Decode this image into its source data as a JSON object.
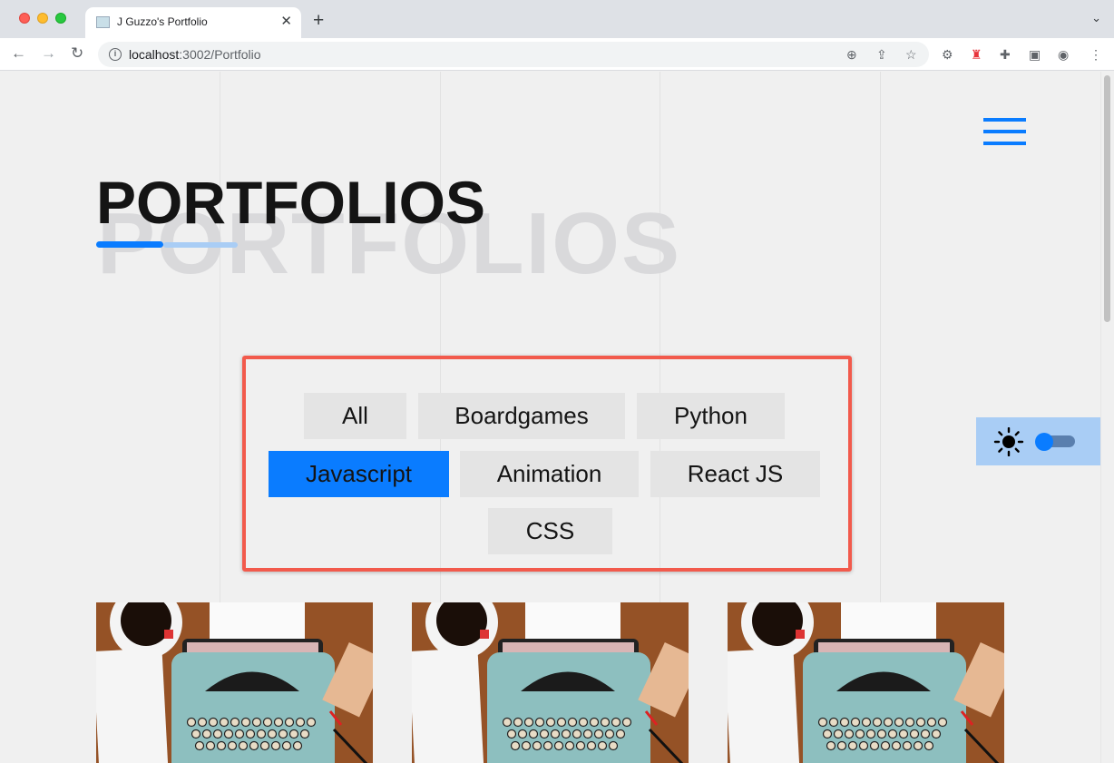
{
  "browser": {
    "tab_title": "J Guzzo's Portfolio",
    "tab_close": "✕",
    "new_tab": "+",
    "tab_menu": "⌄",
    "url_host": "localhost",
    "url_path": ":3002/Portfolio",
    "nav": {
      "back": "←",
      "forward": "→",
      "reload": "↻"
    },
    "omnibox_icons": {
      "zoom": "⊕",
      "share": "⇪",
      "bookmark": "☆"
    },
    "toolbar_icons": {
      "extension_1": "⚙",
      "extension_2": "♜",
      "extensions": "✚",
      "sidepanel": "▣",
      "profile": "◉",
      "menu": "⋮"
    }
  },
  "page": {
    "title": "PORTFOLIOS",
    "background_title": "PORTFOLIOS",
    "accent_color": "#0a7cff",
    "filters": [
      {
        "label": "All",
        "active": false
      },
      {
        "label": "Boardgames",
        "active": false
      },
      {
        "label": "Python",
        "active": false
      },
      {
        "label": "Javascript",
        "active": true
      },
      {
        "label": "Animation",
        "active": false
      },
      {
        "label": "React JS",
        "active": false
      },
      {
        "label": "CSS",
        "active": false
      }
    ],
    "theme_toggle": {
      "icon": "sun-icon",
      "dark_mode": false
    },
    "cards": [
      {
        "image": "typewriter-photo"
      },
      {
        "image": "typewriter-photo"
      },
      {
        "image": "typewriter-photo"
      }
    ]
  }
}
